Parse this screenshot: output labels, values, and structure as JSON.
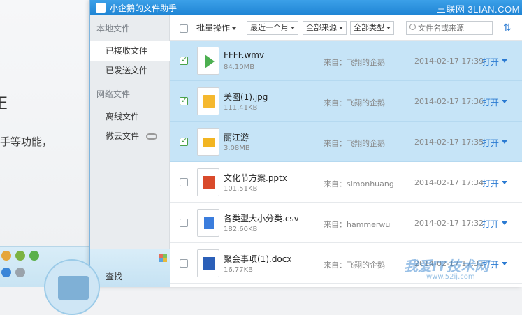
{
  "window": {
    "title": "小企鹅的文件助手"
  },
  "watermark": {
    "top": "三联网 3LIAN.COM",
    "bottom_main": "我爱IT技术网",
    "bottom_sub": "www.52ij.com"
  },
  "background": {
    "big_text": "E",
    "line_text": "手等功能，"
  },
  "sidebar": {
    "group_local": "本地文件",
    "group_network": "网络文件",
    "items": [
      {
        "label": "已接收文件",
        "active": true
      },
      {
        "label": "已发送文件",
        "active": false
      },
      {
        "label": "离线文件",
        "active": false
      },
      {
        "label": "微云文件",
        "active": false
      }
    ],
    "search_label": "查找"
  },
  "toolbar": {
    "batch_label": "批量操作",
    "filter_time": "最近一个月",
    "filter_source": "全部来源",
    "filter_type": "全部类型",
    "search_placeholder": "文件名或来源"
  },
  "files": [
    {
      "name": "FFFF.wmv",
      "size": "84.10MB",
      "source": "来自：飞翔的企鹅",
      "date": "2014-02-17 17:39",
      "action": "打开",
      "selected": true,
      "icon": "video-file-icon",
      "color": "#4caf50"
    },
    {
      "name": "美图(1).jpg",
      "size": "111.41KB",
      "source": "来自：飞翔的企鹅",
      "date": "2014-02-17 17:36",
      "action": "打开",
      "selected": true,
      "icon": "image-file-icon",
      "color": "#f5b82e"
    },
    {
      "name": "丽江游",
      "size": "3.08MB",
      "source": "来自：飞翔的企鹅",
      "date": "2014-02-17 17:35",
      "action": "打开",
      "selected": true,
      "icon": "folder-icon",
      "color": "#f2b522"
    },
    {
      "name": "文化节方案.pptx",
      "size": "101.51KB",
      "source": "来自：simonhuang",
      "date": "2014-02-17 17:34",
      "action": "打开",
      "selected": false,
      "icon": "pptx-file-icon",
      "color": "#d94a2b"
    },
    {
      "name": "各类型大小分类.csv",
      "size": "182.60KB",
      "source": "来自：hammerwu",
      "date": "2014-02-17 17:32",
      "action": "打开",
      "selected": false,
      "icon": "csv-file-icon",
      "color": "#3b7ddd"
    },
    {
      "name": "聚会事项(1).docx",
      "size": "16.77KB",
      "source": "来自：飞翔的企鹅",
      "date": "2014-02-17 17:31",
      "action": "打开",
      "selected": false,
      "icon": "docx-file-icon",
      "color": "#2b5fb8"
    }
  ]
}
